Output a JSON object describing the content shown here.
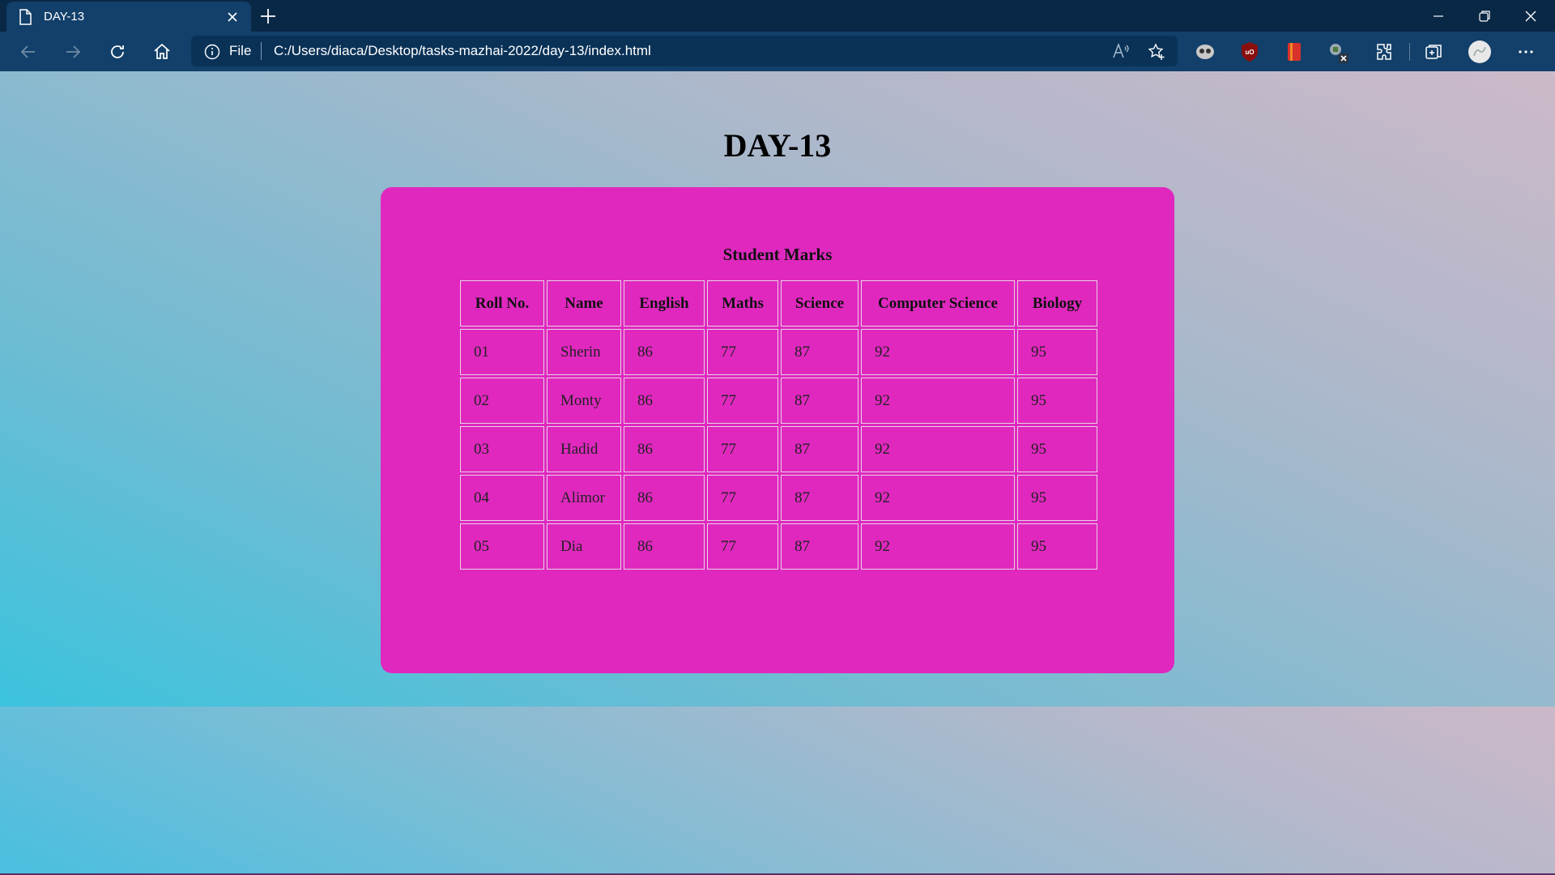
{
  "browser": {
    "tab_title": "DAY-13",
    "address_scheme": "File",
    "address_url": "C:/Users/diaca/Desktop/tasks-mazhai-2022/day-13/index.html",
    "accent_color": "#12406a"
  },
  "page": {
    "title": "DAY-13",
    "card_color": "#e028bf"
  },
  "table": {
    "caption": "Student Marks",
    "headers": [
      "Roll No.",
      "Name",
      "English",
      "Maths",
      "Science",
      "Computer Science",
      "Biology"
    ],
    "rows": [
      [
        "01",
        "Sherin",
        "86",
        "77",
        "87",
        "92",
        "95"
      ],
      [
        "02",
        "Monty",
        "86",
        "77",
        "87",
        "92",
        "95"
      ],
      [
        "03",
        "Hadid",
        "86",
        "77",
        "87",
        "92",
        "95"
      ],
      [
        "04",
        "Alimor",
        "86",
        "77",
        "87",
        "92",
        "95"
      ],
      [
        "05",
        "Dia",
        "86",
        "77",
        "87",
        "92",
        "95"
      ]
    ]
  },
  "icons": {
    "tab": "document-icon",
    "toolbar": [
      "back-icon",
      "forward-icon",
      "refresh-icon",
      "home-icon",
      "info-icon",
      "read-aloud-icon",
      "add-favorite-icon",
      "extension-icons",
      "extensions-icon",
      "collections-icon",
      "profile-icon",
      "more-icon"
    ]
  }
}
